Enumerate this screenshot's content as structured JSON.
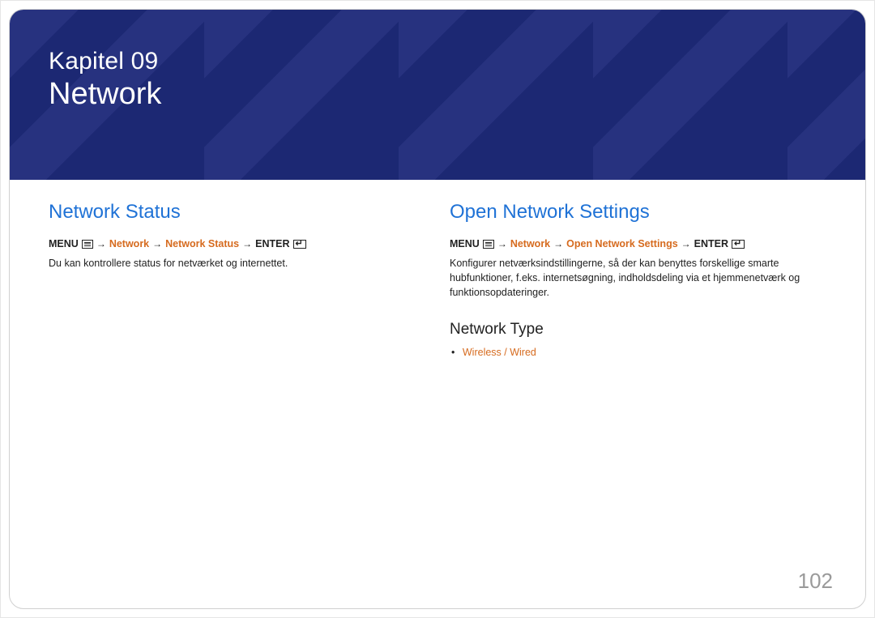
{
  "banner": {
    "chapter": "Kapitel 09",
    "title": "Network"
  },
  "left": {
    "heading": "Network Status",
    "nav": {
      "menu": "MENU",
      "n1": "Network",
      "n2": "Network Status",
      "enter": "ENTER"
    },
    "body": "Du kan kontrollere status for netværket og internettet."
  },
  "right": {
    "heading": "Open Network Settings",
    "nav": {
      "menu": "MENU",
      "n1": "Network",
      "n2": "Open Network Settings",
      "enter": "ENTER"
    },
    "body": "Konfigurer netværksindstillingerne, så der kan benyttes forskellige smarte hubfunktioner, f.eks. internetsøgning, indholdsdeling via et hjemmenetværk og funktionsopdateringer.",
    "subheading": "Network Type",
    "options": {
      "opt1": "Wireless",
      "sep": " / ",
      "opt2": "Wired"
    }
  },
  "page_number": "102"
}
